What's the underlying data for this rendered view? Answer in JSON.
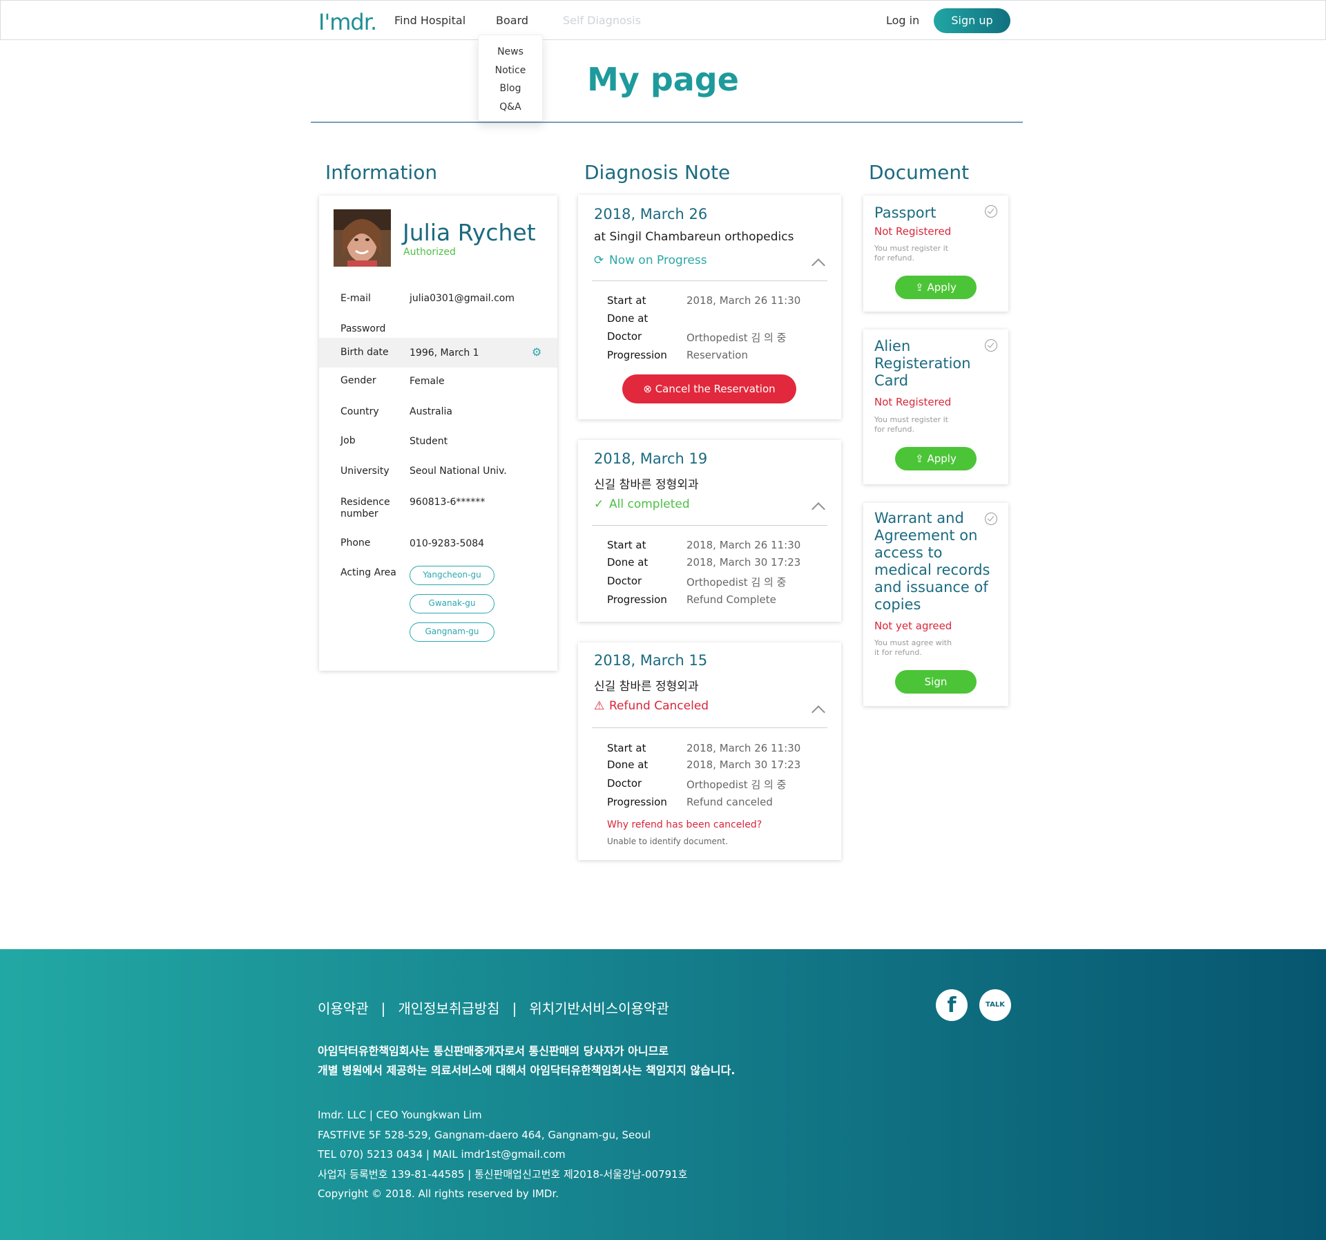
{
  "header": {
    "logo": "I'mdr.",
    "nav": [
      "Find Hospital",
      "Board",
      "Self Diagnosis"
    ],
    "login": "Log in",
    "signup": "Sign up",
    "board_menu": [
      "News",
      "Notice",
      "Blog",
      "Q&A"
    ]
  },
  "page_title": "My page",
  "sections": {
    "information": "Information",
    "diagnosis": "Diagnosis Note",
    "document": "Document"
  },
  "profile": {
    "name": "Julia Rychet",
    "status": "Authorized",
    "rows": [
      {
        "label": "E-mail",
        "value": "julia0301@gmail.com"
      },
      {
        "label": "Password",
        "value": ""
      },
      {
        "label": "Birth date",
        "value": "1996, March 1"
      },
      {
        "label": "Gender",
        "value": "Female"
      },
      {
        "label": "Country",
        "value": "Australia"
      },
      {
        "label": "Job",
        "value": "Student"
      },
      {
        "label": "University",
        "value": "Seoul National Univ."
      },
      {
        "label": "Residence number",
        "value": "960813-6******"
      },
      {
        "label": "Phone",
        "value": "010-9283-5084"
      },
      {
        "label": "Acting Area",
        "value": ""
      }
    ],
    "areas": [
      "Yangcheon-gu",
      "Gwanak-gu",
      "Gangnam-gu"
    ]
  },
  "diagnosis": [
    {
      "date": "2018, March 26",
      "place": "at Singil Chambareun orthopedics",
      "status": "Now on Progress",
      "labels": [
        "Start at",
        "Done at",
        "Doctor",
        "Progression"
      ],
      "values": [
        "2018, March 26 11:30",
        "",
        "Orthopedist 김 의 중",
        "Reservation"
      ],
      "cancel_label": "Cancel the Reservation"
    },
    {
      "date": "2018, March 19",
      "place": "신길 참바른 정형외과",
      "status": "All completed",
      "labels": [
        "Start at",
        "Done at",
        "Doctor",
        "Progression"
      ],
      "values": [
        "2018, March 26 11:30",
        "2018, March 30 17:23",
        "Orthopedist 김 의 중",
        "Refund Complete"
      ]
    },
    {
      "date": "2018, March 15",
      "place": "신길 참바른 정형외과",
      "status": "Refund Canceled",
      "labels": [
        "Start at",
        "Done at",
        "Doctor",
        "Progression"
      ],
      "values": [
        "2018, March 26 11:30",
        "2018, March 30 17:23",
        "Orthopedist 김 의 중",
        "Refund canceled"
      ],
      "why": "Why refend has been canceled?",
      "why_detail": "Unable to identify document."
    }
  ],
  "documents": [
    {
      "title": "Passport",
      "status": "Not Registered",
      "note": "You must register it for refund.",
      "button": "Apply"
    },
    {
      "title": "Alien Registeration Card",
      "status": "Not Registered",
      "note": "You must register it for refund.",
      "button": "Apply"
    },
    {
      "title": "Warrant and Agreement on access to medical records and issuance of copies",
      "status": "Not yet agreed",
      "note": "You must agree with it for refund.",
      "button": "Sign"
    }
  ],
  "footer": {
    "links": [
      "이용약관",
      "개인정보취급방침",
      "위치기반서비스이용약관"
    ],
    "disclaimer_1": "아임닥터유한책임회사는 통신판매중개자로서 통신판매의 당사자가 아니므로",
    "disclaimer_2": "개별 병원에서 제공하는 의료서비스에 대해서 아임닥터유한책임회사는 책임지지 않습니다.",
    "info": [
      "Imdr. LLC | CEO Youngkwan Lim",
      "FASTFIVE 5F 528-529, Gangnam-daero 464, Gangnam-gu, Seoul",
      "TEL 070) 5213 0434 | MAIL  imdr1st@gmail.com",
      "사업자 등록번호 139-81-44585 | 통신판매업신고번호 제2018-서울강남-00791호",
      "Copyright © 2018. All rights reserved by IMDr."
    ],
    "social": [
      "f",
      "TALK"
    ]
  },
  "colors": {
    "brand": "#1e9a9c",
    "heading": "#1b6a80",
    "danger": "#e2283c",
    "success": "#4cc437"
  }
}
